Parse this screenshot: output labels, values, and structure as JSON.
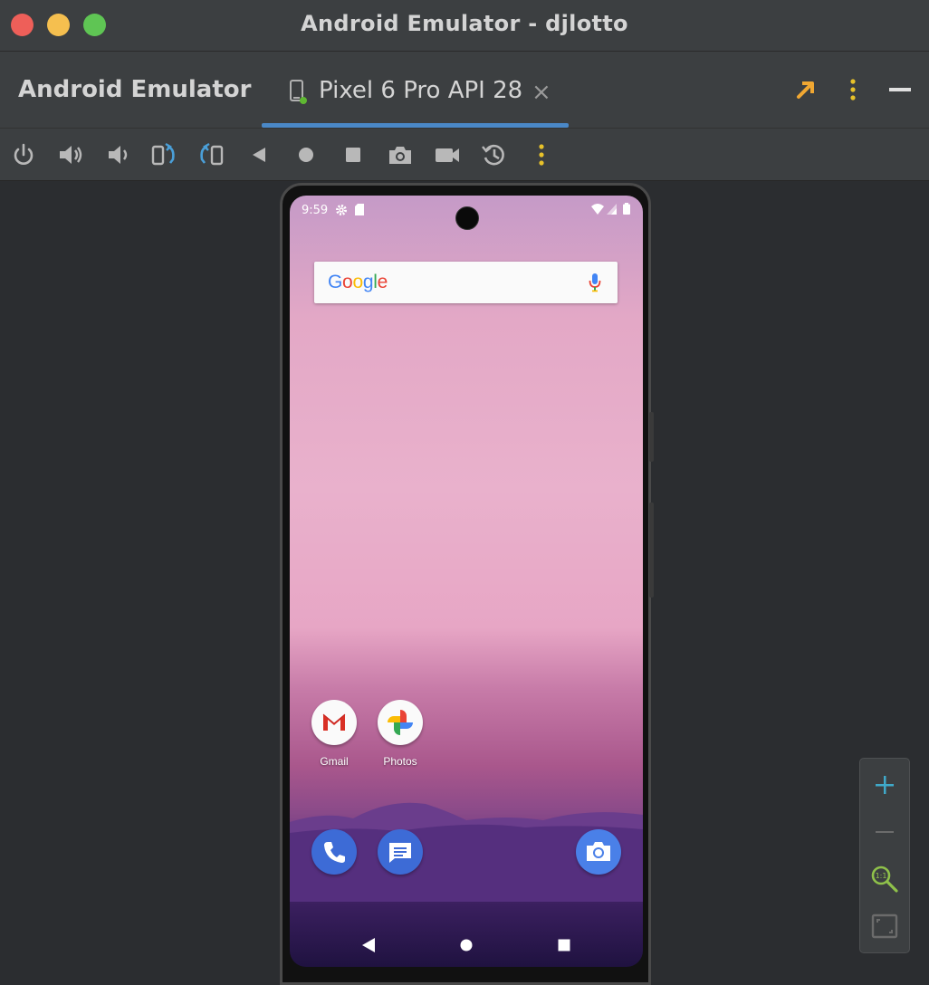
{
  "window": {
    "title": "Android Emulator - djlotto"
  },
  "tool_window": {
    "title": "Android Emulator",
    "tab": {
      "label": "Pixel 6 Pro API 28",
      "close": "×"
    }
  },
  "toolbar": {
    "buttons": [
      "power-icon",
      "volume-up-icon",
      "volume-down-icon",
      "rotate-left-icon",
      "rotate-right-icon",
      "back-icon",
      "home-icon",
      "overview-icon",
      "screenshot-icon",
      "screen-record-icon",
      "snapshot-icon",
      "more-icon"
    ]
  },
  "device": {
    "status_bar": {
      "time": "9:59"
    },
    "search_widget": {
      "logo": [
        {
          "char": "G",
          "color": "#4285F4"
        },
        {
          "char": "o",
          "color": "#EA4335"
        },
        {
          "char": "o",
          "color": "#FBBC05"
        },
        {
          "char": "g",
          "color": "#4285F4"
        },
        {
          "char": "l",
          "color": "#34A853"
        },
        {
          "char": "e",
          "color": "#EA4335"
        }
      ]
    },
    "home_apps": [
      {
        "label": "Gmail"
      },
      {
        "label": "Photos"
      }
    ],
    "dock_apps": [
      "phone-icon",
      "messages-icon",
      "camera-icon"
    ]
  },
  "colors": {
    "accent": "#4a88c7",
    "warning_arrow": "#f0a732",
    "more_dots": "#e8c22a",
    "zoom_plus": "#3fa9c9",
    "zoom_one_to_one": "#8fc14a"
  }
}
